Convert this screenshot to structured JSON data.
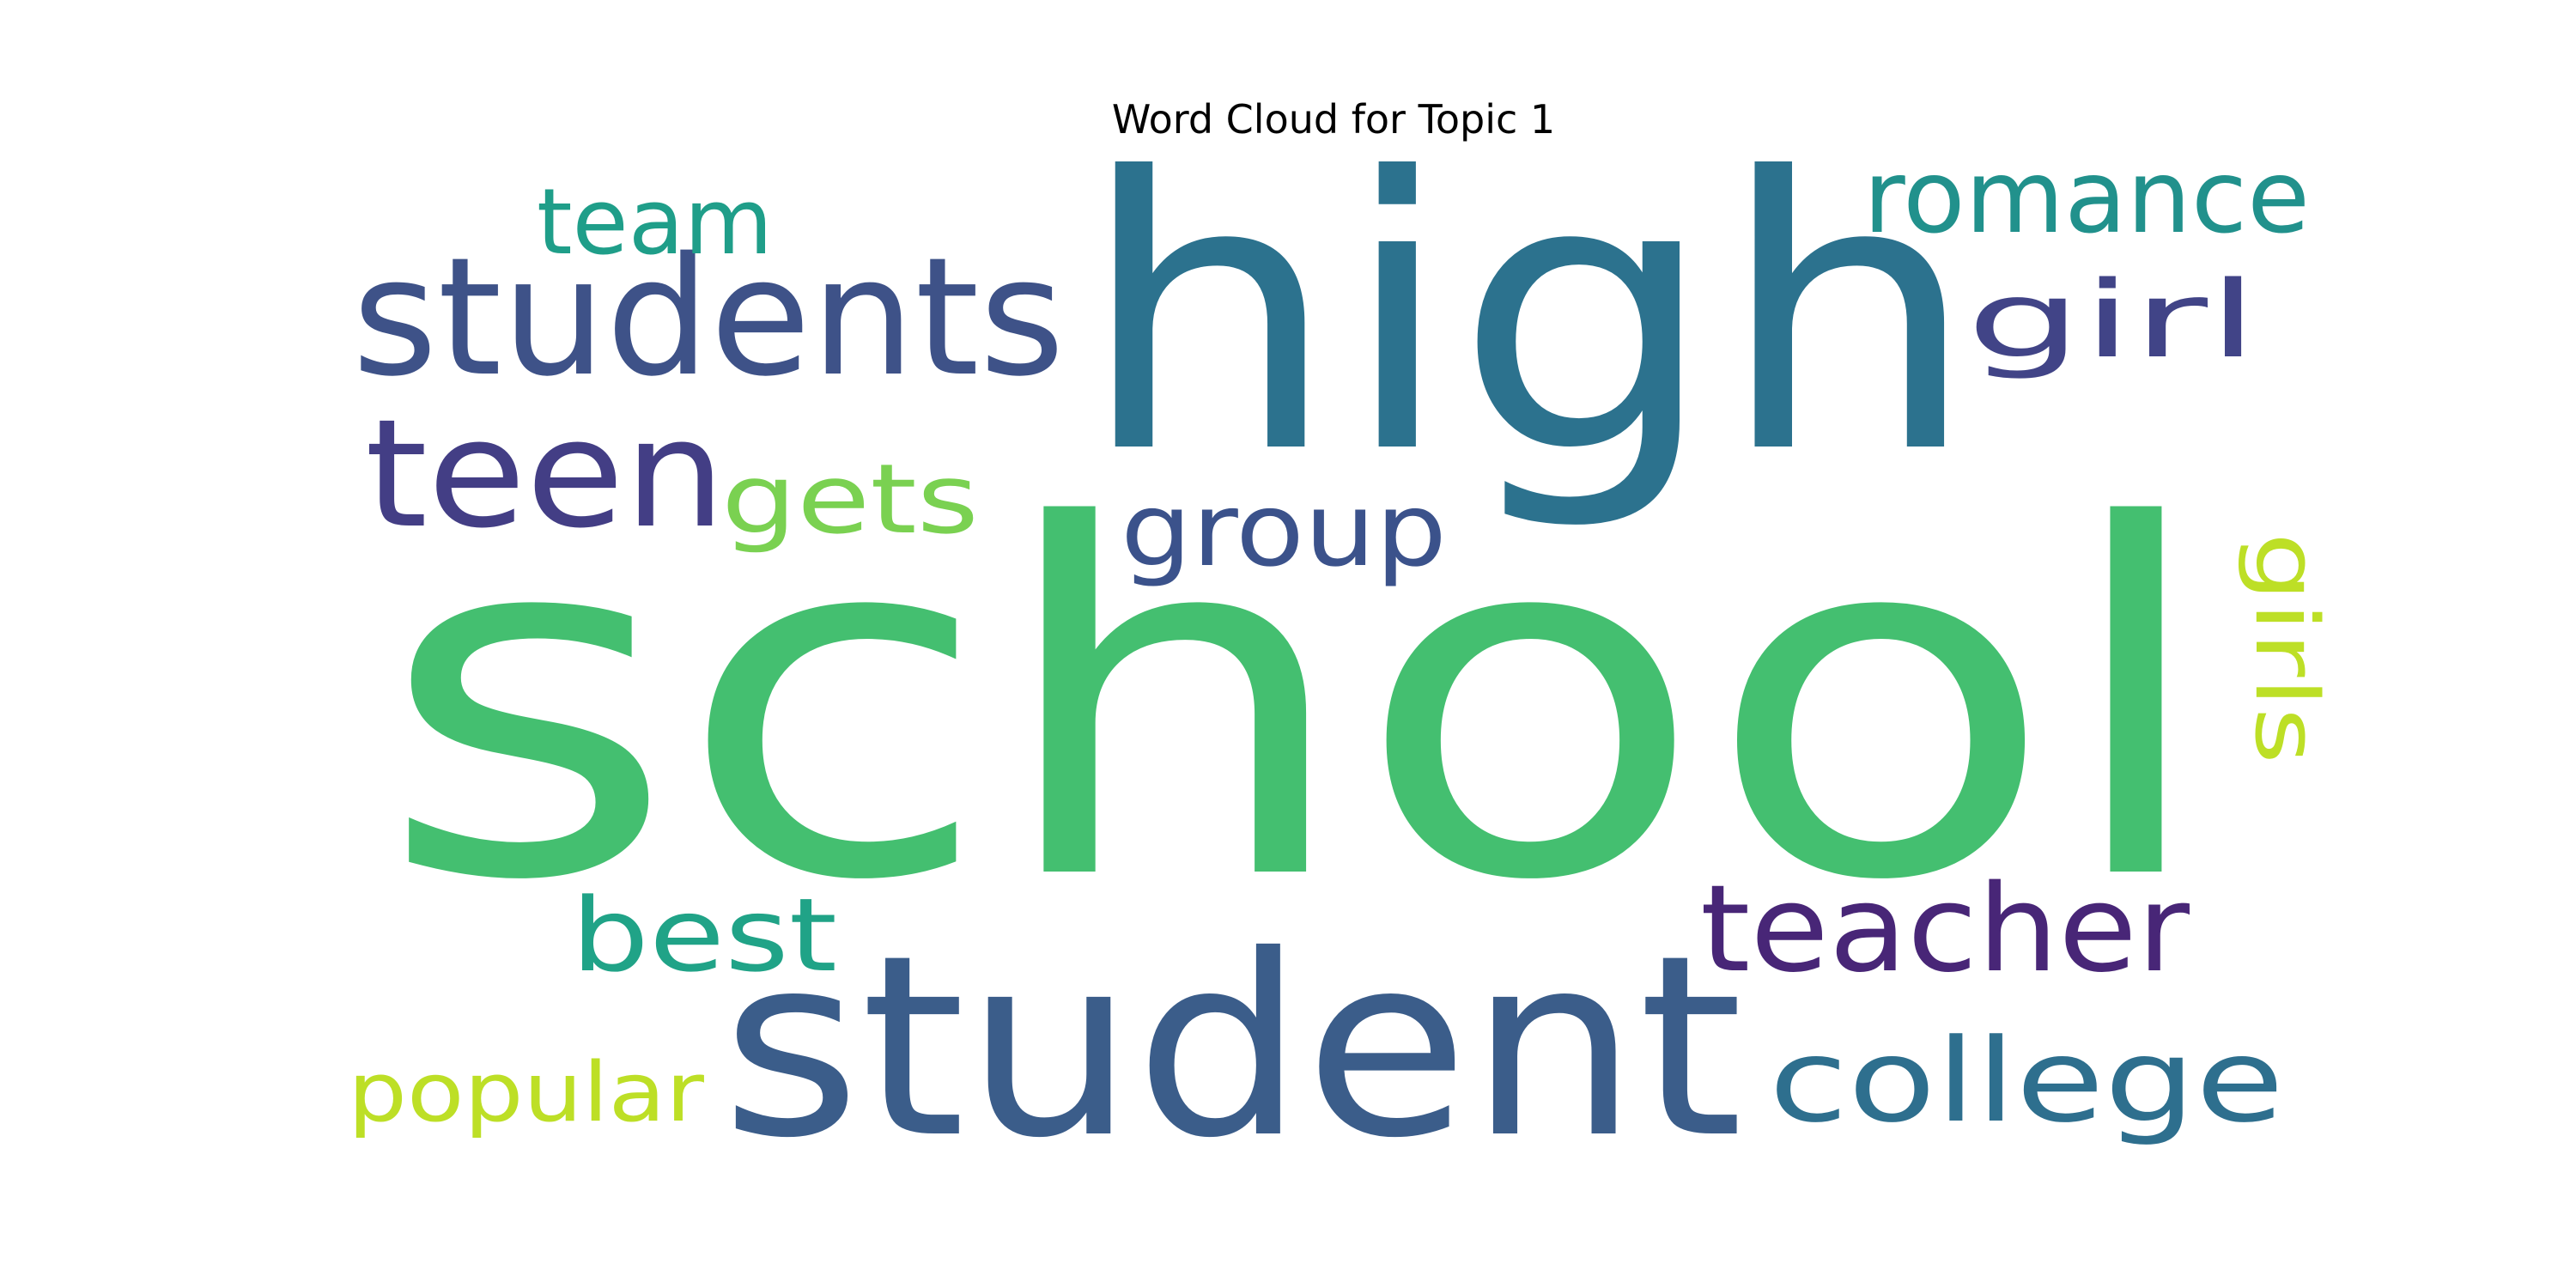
{
  "chart_data": {
    "type": "wordcloud",
    "title": "Word Cloud for Topic 1",
    "words": [
      {
        "text": "school",
        "weight": 1.0,
        "color": "#44bf70"
      },
      {
        "text": "high",
        "weight": 0.78,
        "color": "#2c728e"
      },
      {
        "text": "student",
        "weight": 0.52,
        "color": "#3b5d8a"
      },
      {
        "text": "students",
        "weight": 0.34,
        "color": "#3e5288"
      },
      {
        "text": "teen",
        "weight": 0.31,
        "color": "#433e85"
      },
      {
        "text": "teacher",
        "weight": 0.25,
        "color": "#482677"
      },
      {
        "text": "college",
        "weight": 0.24,
        "color": "#2e6f8e"
      },
      {
        "text": "romance",
        "weight": 0.21,
        "color": "#21918c"
      },
      {
        "text": "girl",
        "weight": 0.22,
        "color": "#414487"
      },
      {
        "text": "group",
        "weight": 0.21,
        "color": "#3b528b"
      },
      {
        "text": "best",
        "weight": 0.21,
        "color": "#20a387"
      },
      {
        "text": "team",
        "weight": 0.19,
        "color": "#1f9e89"
      },
      {
        "text": "gets",
        "weight": 0.2,
        "color": "#7ad151"
      },
      {
        "text": "girls",
        "weight": 0.18,
        "color": "#bddf26"
      },
      {
        "text": "popular",
        "weight": 0.17,
        "color": "#bddf26"
      }
    ]
  }
}
